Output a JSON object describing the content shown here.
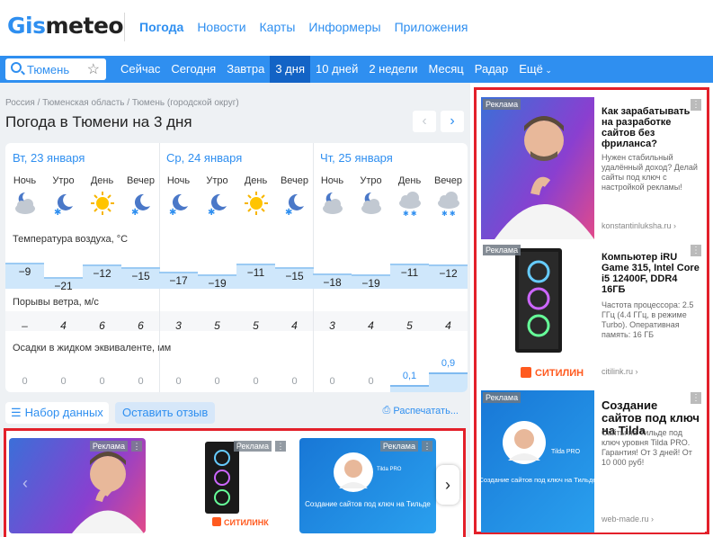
{
  "header": {
    "logo_part1": "Gis",
    "logo_part2": "meteo",
    "nav": [
      "Погода",
      "Новости",
      "Карты",
      "Информеры",
      "Приложения"
    ]
  },
  "bluebar": {
    "search_value": "Тюмень",
    "nav": [
      "Сейчас",
      "Сегодня",
      "Завтра",
      "3 дня",
      "10 дней",
      "2 недели",
      "Месяц",
      "Радар",
      "Ещё"
    ],
    "active": "3 дня"
  },
  "breadcrumb": "Россия / Тюменская область / Тюмень (городской округ)",
  "page_title": "Погода в Тюмени на 3 дня",
  "days": [
    {
      "title": "Вт, 23 января"
    },
    {
      "title": "Ср, 24 января"
    },
    {
      "title": "Чт, 25 января"
    }
  ],
  "periods": [
    "Ночь",
    "Утро",
    "День",
    "Вечер",
    "Ночь",
    "Утро",
    "День",
    "Вечер",
    "Ночь",
    "Утро",
    "День",
    "Вечер"
  ],
  "icons": [
    "moon-cloud-icon",
    "moon-snow-icon",
    "sun-icon",
    "moon-snow-icon",
    "moon-snow-icon",
    "moon-snow-icon",
    "sun-icon",
    "moon-snow-icon",
    "moon-cloud-icon",
    "moon-cloud-icon",
    "cloud-snow-icon",
    "cloud-snow-icon"
  ],
  "temp_label": "Температура воздуха, °C",
  "temps": [
    "−9",
    "−21",
    "−12",
    "−15",
    "−17",
    "−19",
    "−11",
    "−15",
    "−18",
    "−19",
    "−11",
    "−12"
  ],
  "wind_label": "Порывы ветра, м/с",
  "wind": [
    "–",
    "4",
    "6",
    "6",
    "3",
    "5",
    "5",
    "4",
    "3",
    "4",
    "5",
    "4"
  ],
  "precip_label": "Осадки в жидком эквиваленте, мм",
  "precip": [
    "0",
    "0",
    "0",
    "0",
    "0",
    "0",
    "0",
    "0",
    "0",
    "0",
    "0,1",
    "0,9"
  ],
  "buttons": {
    "data_set": "Набор данных",
    "review": "Оставить отзыв",
    "print": "Распечатать..."
  },
  "ad_label": "Реклама",
  "right_ads": [
    {
      "title": "Как зарабатывать на разработке сайтов без фриланса?",
      "desc": "Нужен стабильный удалённый доход? Делай сайты под ключ с настройкой рекламы!",
      "link": "konstantinluksha.ru"
    },
    {
      "title": "Компьютер iRU Game 315, Intel Core i5 12400F, DDR4 16ГБ",
      "desc": "Частота процессора: 2.5 ГГц (4.4 ГГц, в режиме Turbo). Оперативная память: 16 ГБ",
      "link": "citilink.ru",
      "brand": "СИТИЛИН"
    },
    {
      "title": "Создание сайтов под ключ на Tilda",
      "desc": "Сайты на Тильде под ключ уровня Tilda PRO. Гарантия! От 3 дней! От 10 000 руб!",
      "link": "web-made.ru",
      "img_text": "Создание сайтов под ключ на Тильде",
      "img_badge": "Tilda PRO"
    }
  ],
  "strip": {
    "brand": "СИТИЛИНК",
    "tilda_text": "Создание сайтов под ключ на Тильде",
    "tilda_badge": "Tilda PRO"
  },
  "colors": {
    "accent": "#2f8ff0",
    "active_tab": "#1363c5",
    "ad_border": "#e3202a"
  }
}
